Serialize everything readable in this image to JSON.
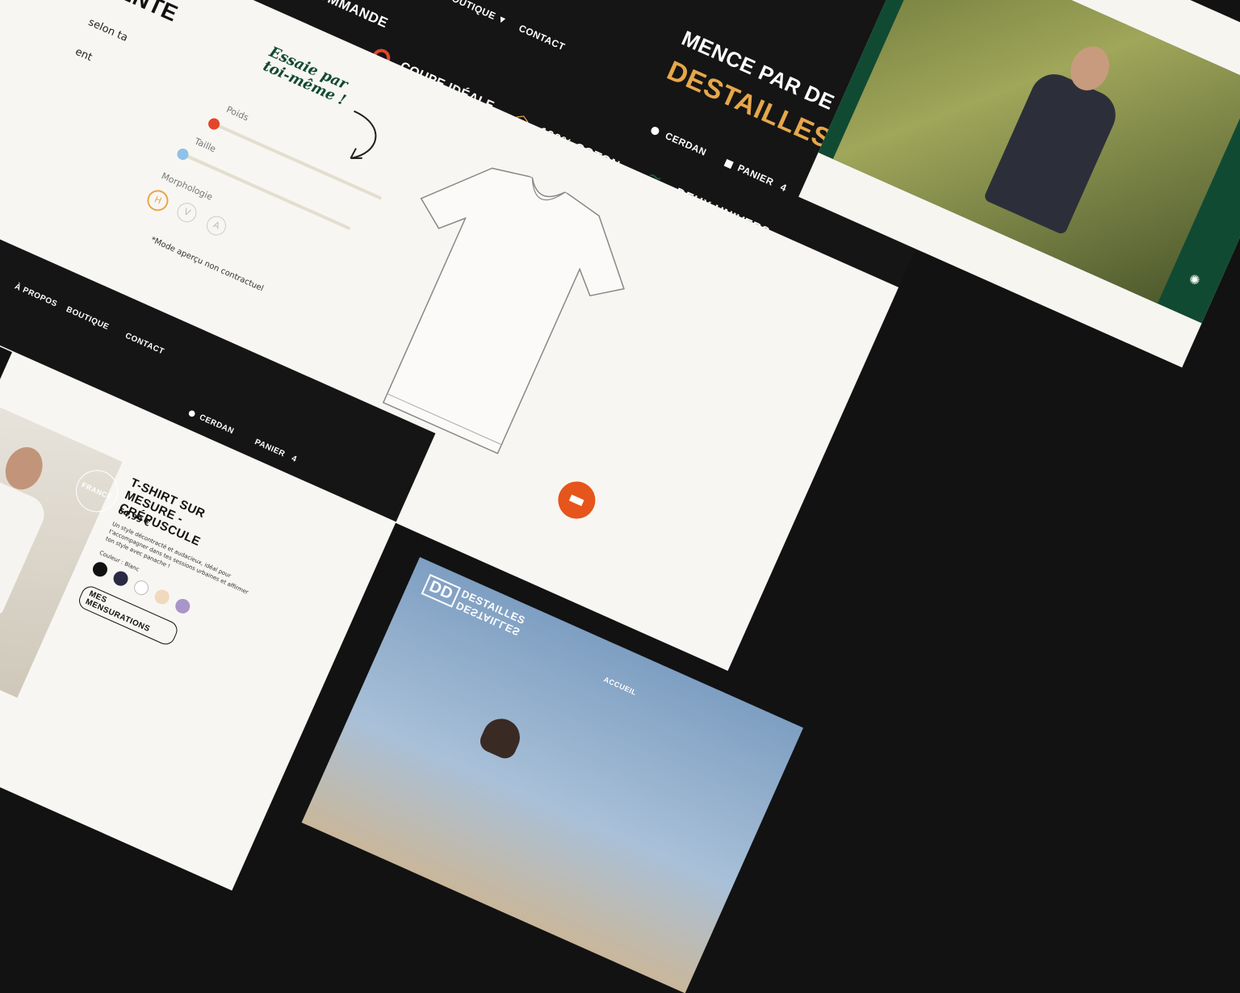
{
  "main": {
    "nav": {
      "preorder": "PRÉ-COMMANDE",
      "shop": "BOUTIQUE",
      "contact": "CONTACT",
      "tagline": "MENCE PAR DE SIMPLES",
      "logo": "DESTAILLES",
      "account": "CERDAN",
      "cart": "PANIER",
      "cart_count": "4"
    },
    "features": {
      "fit": "COUPE IDÉALE",
      "cotton": "100% COTON",
      "universes": "DEUX UNIVERS"
    },
    "left_title": "VENTE",
    "left_text1": "selon ta",
    "left_text2": "ent",
    "try_label": "Essaie par toi-même !",
    "sliders": {
      "weight_label": "Poids",
      "height_label": "Taille",
      "morph_label": "Morphologie",
      "weight_value": 0,
      "height_value": 0,
      "morph_options": [
        "H",
        "V",
        "A"
      ]
    },
    "disclaimer": "*Mode aperçu non contractuel"
  },
  "product": {
    "nav": {
      "about": "À PROPOS",
      "shop": "BOUTIQUE",
      "contact": "CONTACT",
      "account": "CERDAN",
      "cart": "PANIER",
      "cart_count": "4"
    },
    "badge": "FRANCE",
    "title": "T-SHIRT SUR MESURE - CRÉPUSCULE",
    "price": "64,99 €",
    "description": "Un style décontracté et audacieux, idéal pour t'accompagner dans tes sessions urbaines et affirmer ton style avec panache !",
    "color_label": "Couleur : Blanc",
    "colors": [
      "#111111",
      "#2b2a45",
      "#ffffff",
      "#f0d9bd",
      "#a995c9"
    ],
    "measure_button": "MES MENSURATIONS"
  },
  "hero": {
    "logo_mark": "DD",
    "logo_text1": "DESTAILLES",
    "logo_text2": "DESTAILLES",
    "nav_home": "ACCUEIL"
  },
  "colors": {
    "accent_red": "#e5452a",
    "accent_orange": "#e6551b",
    "accent_green": "#114a33",
    "accent_yellow": "#e6a74a",
    "accent_blue": "#8ec2e8"
  }
}
